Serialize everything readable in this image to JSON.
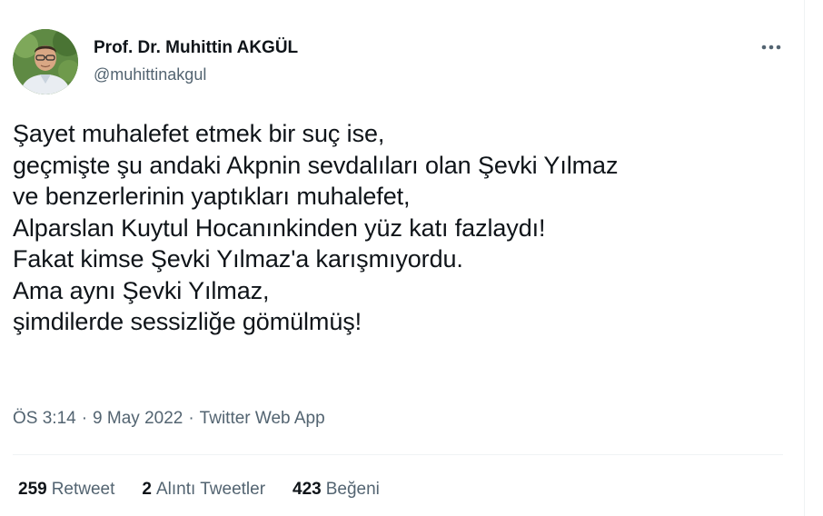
{
  "author": {
    "display_name": "Prof. Dr. Muhittin AKGÜL",
    "handle": "@muhittinakgul"
  },
  "tweet": {
    "lines": [
      "Şayet muhalefet etmek bir suç ise,",
      "geçmişte şu andaki Akpnin sevdalıları olan Şevki Yılmaz",
      "ve benzerlerinin yaptıkları muhalefet,",
      "Alparslan Kuytul Hocanınkinden yüz katı fazlaydı!",
      "Fakat kimse Şevki Yılmaz'a karışmıyordu.",
      "Ama aynı Şevki Yılmaz,",
      "şimdilerde sessizliğe gömülmüş!"
    ],
    "time": "ÖS 3:14",
    "separator": "·",
    "date": "9 May 2022",
    "source": "Twitter Web App"
  },
  "stats": {
    "retweets": {
      "count": "259",
      "label": "Retweet"
    },
    "quotes": {
      "count": "2",
      "label": "Alıntı Tweetler"
    },
    "likes": {
      "count": "423",
      "label": "Beğeni"
    }
  },
  "icons": {
    "more": "more-dots-icon"
  },
  "colors": {
    "text_primary": "#0f1419",
    "text_secondary": "#536471",
    "divider": "#eff3f4"
  }
}
